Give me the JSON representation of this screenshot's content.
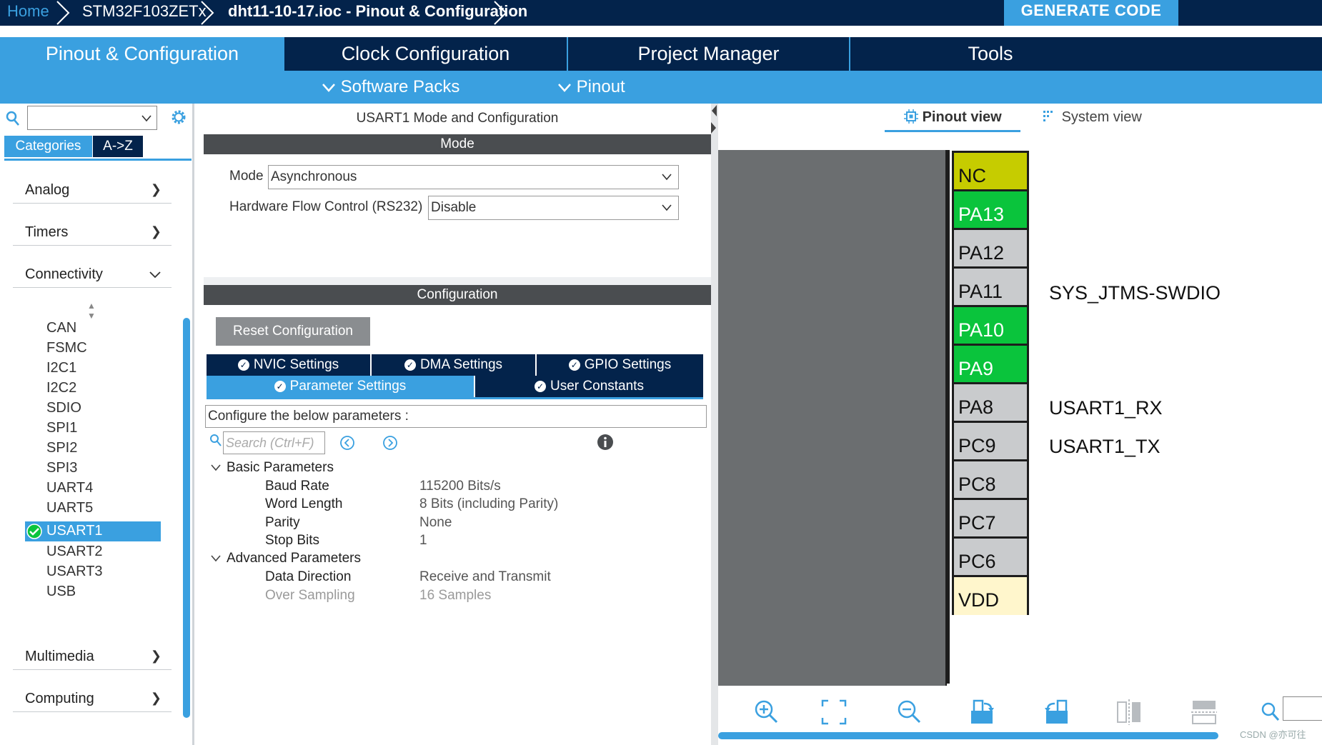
{
  "breadcrumb": {
    "home": "Home",
    "device": "STM32F103ZETx",
    "file": "dht11-10-17.ioc - Pinout & Configuration"
  },
  "generate_button": "GENERATE CODE",
  "main_tabs": [
    {
      "label": "Pinout & Configuration",
      "active": true
    },
    {
      "label": "Clock Configuration",
      "active": false
    },
    {
      "label": "Project Manager",
      "active": false
    },
    {
      "label": "Tools",
      "active": false
    }
  ],
  "subbar": {
    "software_packs": "Software Packs",
    "pinout": "Pinout"
  },
  "left": {
    "search_value": "",
    "tabs": {
      "categories": "Categories",
      "az": "A->Z"
    },
    "categories": {
      "analog": "Analog",
      "timers": "Timers",
      "connectivity": "Connectivity",
      "multimedia": "Multimedia",
      "computing": "Computing"
    },
    "connectivity_items": [
      "CAN",
      "FSMC",
      "I2C1",
      "I2C2",
      "SDIO",
      "SPI1",
      "SPI2",
      "SPI3",
      "UART4",
      "UART5",
      "USART1",
      "USART2",
      "USART3",
      "USB"
    ],
    "selected_item": "USART1"
  },
  "center": {
    "title": "USART1 Mode and Configuration",
    "mode_header": "Mode",
    "mode_label": "Mode",
    "mode_value": "Asynchronous",
    "flow_label": "Hardware Flow Control (RS232)",
    "flow_value": "Disable",
    "config_header": "Configuration",
    "reset_button": "Reset Configuration",
    "config_tabs": {
      "nvic": "NVIC Settings",
      "dma": "DMA Settings",
      "gpio": "GPIO Settings",
      "params": "Parameter Settings",
      "user_constants": "User Constants"
    },
    "configure_text": "Configure the below parameters :",
    "search_placeholder": "Search (Ctrl+F)",
    "basic_group": "Basic Parameters",
    "basic_params": [
      {
        "name": "Baud Rate",
        "value": "115200 Bits/s"
      },
      {
        "name": "Word Length",
        "value": "8 Bits (including Parity)"
      },
      {
        "name": "Parity",
        "value": "None"
      },
      {
        "name": "Stop Bits",
        "value": "1"
      }
    ],
    "advanced_group": "Advanced Parameters",
    "advanced_params": [
      {
        "name": "Data Direction",
        "value": "Receive and Transmit"
      },
      {
        "name": "Over Sampling",
        "value": "16 Samples"
      }
    ]
  },
  "right": {
    "pinout_view": "Pinout view",
    "system_view": "System view",
    "pins": [
      {
        "name": "NC",
        "color": "yellow",
        "signal": ""
      },
      {
        "name": "PA13",
        "color": "green",
        "signal": "SYS_JTMS-SWDIO"
      },
      {
        "name": "PA12",
        "color": "gray",
        "signal": ""
      },
      {
        "name": "PA11",
        "color": "gray",
        "signal": ""
      },
      {
        "name": "PA10",
        "color": "green",
        "signal": "USART1_RX"
      },
      {
        "name": "PA9",
        "color": "green",
        "signal": "USART1_TX"
      },
      {
        "name": "PA8",
        "color": "gray",
        "signal": ""
      },
      {
        "name": "PC9",
        "color": "gray",
        "signal": ""
      },
      {
        "name": "PC8",
        "color": "gray",
        "signal": ""
      },
      {
        "name": "PC7",
        "color": "gray",
        "signal": ""
      },
      {
        "name": "PC6",
        "color": "gray",
        "signal": ""
      },
      {
        "name": "VDD",
        "color": "cream",
        "signal": ""
      }
    ]
  },
  "watermark": "CSDN @亦可往",
  "colors": {
    "navy": "#03234b",
    "accent": "#3aa0e0",
    "pin_green": "#0ac43c",
    "pin_yellow": "#c6cc00"
  }
}
